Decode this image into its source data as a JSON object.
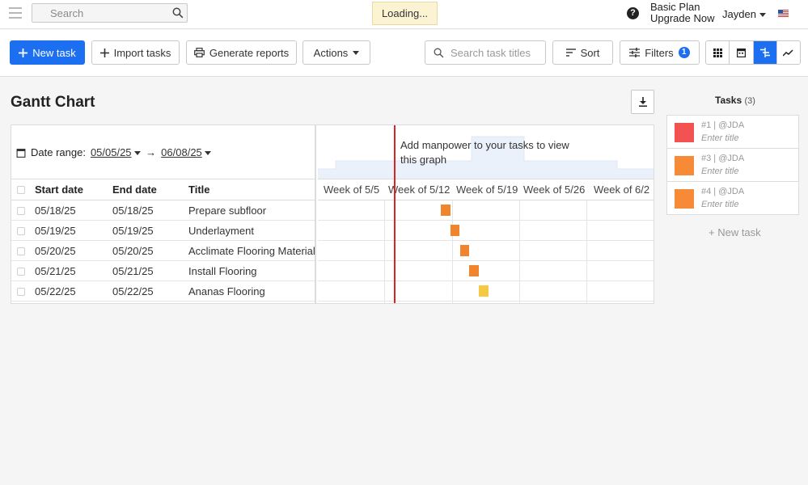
{
  "topbar": {
    "search_placeholder": "Search",
    "loading": "Loading...",
    "plan_name": "Basic Plan",
    "plan_cta": "Upgrade Now",
    "user_name": "Jayden",
    "help_glyph": "?"
  },
  "toolbar": {
    "new_task": "New task",
    "import_tasks": "Import tasks",
    "generate_reports": "Generate reports",
    "actions": "Actions",
    "task_search_placeholder": "Search task titles",
    "sort": "Sort",
    "filters": "Filters",
    "filters_count": "1",
    "active_view": "gantt",
    "views": [
      "grid-view-icon",
      "calendar-view-icon",
      "gantt-view-icon",
      "chart-view-icon"
    ]
  },
  "page": {
    "title": "Gantt Chart"
  },
  "gantt": {
    "date_range_label": "Date range:",
    "date_from": "05/05/25",
    "date_arrow": "→",
    "date_to": "06/08/25",
    "manpower_message": "Add manpower to your tasks to view this graph",
    "columns": {
      "start": "Start date",
      "end": "End date",
      "title": "Title"
    },
    "weeks": [
      "Week of 5/5",
      "Week of 5/12",
      "Week of 5/19",
      "Week of 5/26",
      "Week of 6/2"
    ],
    "today_marker_date": "05/14/25",
    "rows": [
      {
        "start": "05/18/25",
        "end": "05/18/25",
        "title": "Prepare subfloor",
        "color": "#f0852d"
      },
      {
        "start": "05/19/25",
        "end": "05/19/25",
        "title": "Underlayment",
        "color": "#f0852d"
      },
      {
        "start": "05/20/25",
        "end": "05/20/25",
        "title": "Acclimate Flooring Material",
        "color": "#f0852d"
      },
      {
        "start": "05/21/25",
        "end": "05/21/25",
        "title": "Install Flooring",
        "color": "#f0852d"
      },
      {
        "start": "05/22/25",
        "end": "05/22/25",
        "title": "Ananas Flooring",
        "color": "#f6c942"
      }
    ]
  },
  "side_tasks": {
    "title": "Tasks",
    "count": "(3)",
    "items": [
      {
        "id": "#1 | @JDA",
        "placeholder": "Enter title",
        "color": "#f25252"
      },
      {
        "id": "#3 | @JDA",
        "placeholder": "Enter title",
        "color": "#f68a36"
      },
      {
        "id": "#4 | @JDA",
        "placeholder": "Enter title",
        "color": "#f68a36"
      }
    ],
    "new_task": "+ New task"
  },
  "colors": {
    "accent": "#1b6ff0",
    "today_line": "#dd2222"
  }
}
